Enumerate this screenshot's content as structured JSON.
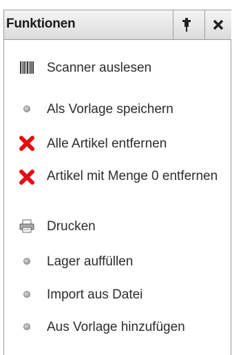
{
  "panel": {
    "title": "Funktionen",
    "pin_icon": "pin-icon",
    "close_icon": "close-icon"
  },
  "items": [
    {
      "label": "Scanner auslesen",
      "icon": "barcode-icon"
    },
    {
      "label": "Als Vorlage speichern",
      "icon": "bullet-icon"
    },
    {
      "label": "Alle Artikel entfernen",
      "icon": "red-x-icon"
    },
    {
      "label": "Artikel mit Menge 0 entfernen",
      "icon": "red-x-icon"
    },
    {
      "label": "Drucken",
      "icon": "printer-icon"
    },
    {
      "label": "Lager auffüllen",
      "icon": "bullet-icon"
    },
    {
      "label": "Import aus Datei",
      "icon": "bullet-icon"
    },
    {
      "label": "Aus Vorlage hinzufügen",
      "icon": "bullet-icon"
    }
  ],
  "colors": {
    "header_bg": "#e4e4e4",
    "border": "#9a9a9a",
    "text": "#2b2b2b",
    "red_x": "#e01010"
  }
}
